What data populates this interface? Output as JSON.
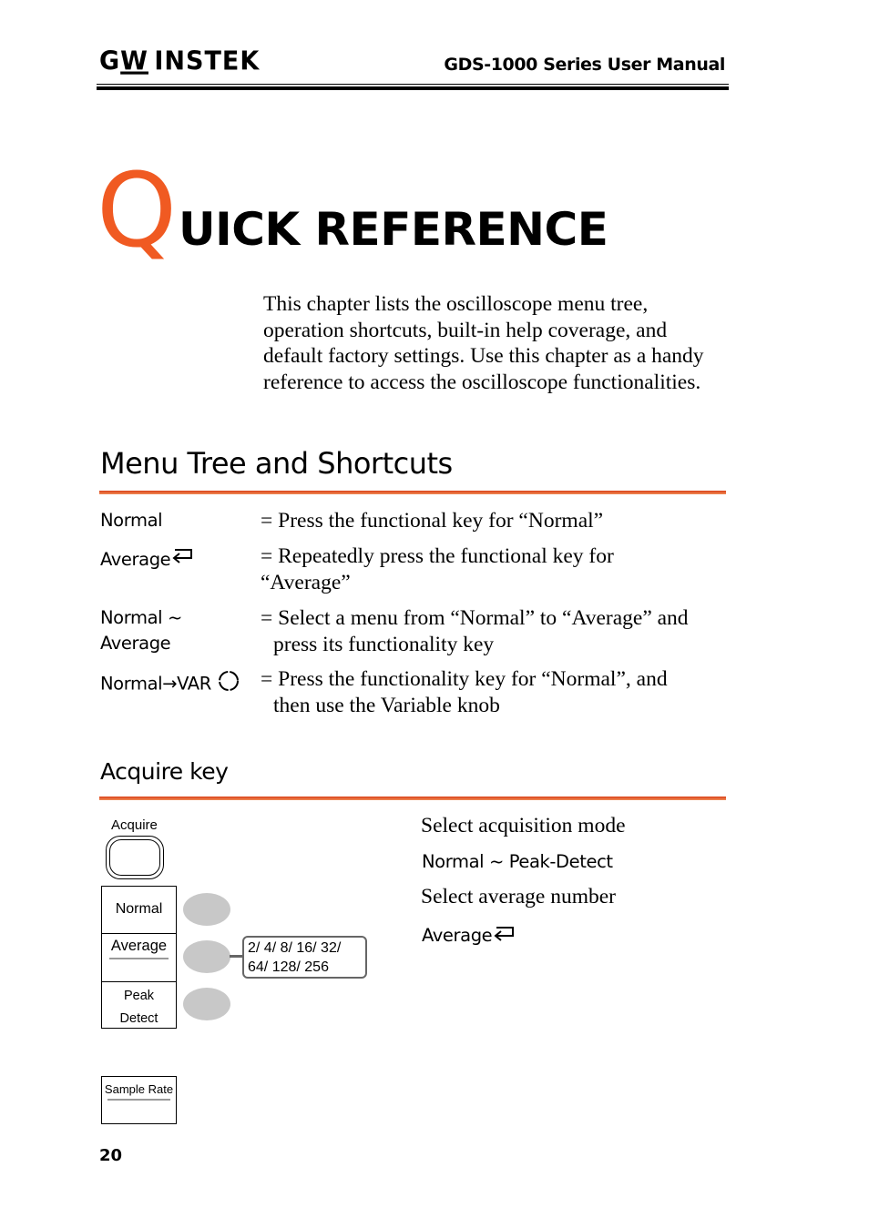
{
  "header": {
    "brand_logo": {
      "part1": "G",
      "part2": "W",
      "part3": "INSTEK"
    },
    "manual_title": "GDS-1000 Series User Manual"
  },
  "chapter": {
    "initial": "Q",
    "title_rest": "UICK REFERENCE",
    "intro": "This chapter lists the oscilloscope menu tree, operation shortcuts, built-in help coverage, and default factory settings. Use this chapter as a handy reference to access the oscilloscope functionalities.",
    "accent_color": "#f05a22"
  },
  "menu_tree_section": {
    "heading": "Menu Tree and Shortcuts",
    "legend": [
      {
        "term": "Normal",
        "desc_line1": "= Press the functional key for “Normal”",
        "desc_line2": ""
      },
      {
        "term": "Average",
        "icon": "return-arrow-icon",
        "desc_line1": "= Repeatedly press the functional key for",
        "desc_line2": "“Average”"
      },
      {
        "term_line1": "Normal ~",
        "term_line2": "Average",
        "desc_line1": "= Select a menu from “Normal” to “Average” and",
        "desc_line2": "press its functionality key"
      },
      {
        "term": "Normal→VAR",
        "icon": "variable-knob-icon",
        "desc_line1": "= Press the functionality key for “Normal”, and",
        "desc_line2": "then use the Variable knob"
      }
    ]
  },
  "acquire_section": {
    "heading": "Acquire key",
    "key_label": "Acquire",
    "menu_items": [
      {
        "label": "Normal"
      },
      {
        "label": "Average",
        "underlined": true
      },
      {
        "label_line1": "Peak",
        "label_line2": "Detect"
      }
    ],
    "average_options_line1": "2/ 4/ 8/ 16/ 32/",
    "average_options_line2": "64/ 128/ 256",
    "descriptions": {
      "mode_title": "Select acquisition mode",
      "mode_range": "Normal ~ Peak-Detect",
      "avg_title": "Select average number",
      "avg_term": "Average"
    },
    "sample_rate_label": "Sample Rate"
  },
  "footer": {
    "page_number": "20"
  }
}
